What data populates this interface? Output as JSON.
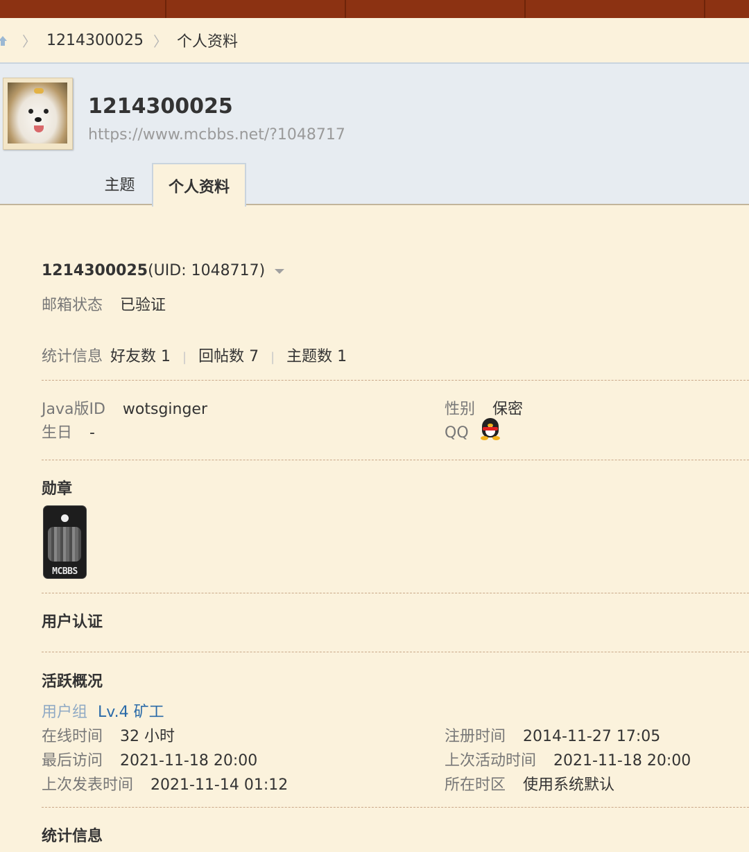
{
  "breadcrumb": {
    "user": "1214300025",
    "page": "个人资料"
  },
  "header": {
    "username": "1214300025",
    "profile_url": "https://www.mcbbs.net/?1048717",
    "tabs": [
      {
        "label": "主题"
      },
      {
        "label": "个人资料"
      }
    ]
  },
  "profile": {
    "name": "1214300025",
    "uid_text": "(UID: 1048717)",
    "email_label": "邮箱状态",
    "email_value": "已验证",
    "stats_label": "统计信息",
    "friends": "好友数 1",
    "replies": "回帖数 7",
    "threads": "主题数 1",
    "pipe": "|",
    "java_label": "Java版ID",
    "java_value": "wotsginger",
    "birthday_label": "生日",
    "birthday_value": "-",
    "gender_label": "性别",
    "gender_value": "保密",
    "qq_label": "QQ"
  },
  "sections": {
    "medals": "勋章",
    "medal_text": "MCBBS",
    "verification": "用户认证",
    "activity": "活跃概况",
    "statistics": "统计信息"
  },
  "activity": {
    "group_label": "用户组",
    "group_value": "Lv.4 矿工",
    "online_label": "在线时间",
    "online_value": "32 小时",
    "register_label": "注册时间",
    "register_value": "2014-11-27 17:05",
    "last_visit_label": "最后访问",
    "last_visit_value": "2021-11-18 20:00",
    "last_active_label": "上次活动时间",
    "last_active_value": "2021-11-18 20:00",
    "last_post_label": "上次发表时间",
    "last_post_value": "2021-11-14 01:12",
    "timezone_label": "所在时区",
    "timezone_value": "使用系统默认"
  },
  "colors": {
    "nav": "#8c3212",
    "background": "#fbf2dc",
    "header": "#e7ecf1",
    "link": "#2a6aa8"
  }
}
